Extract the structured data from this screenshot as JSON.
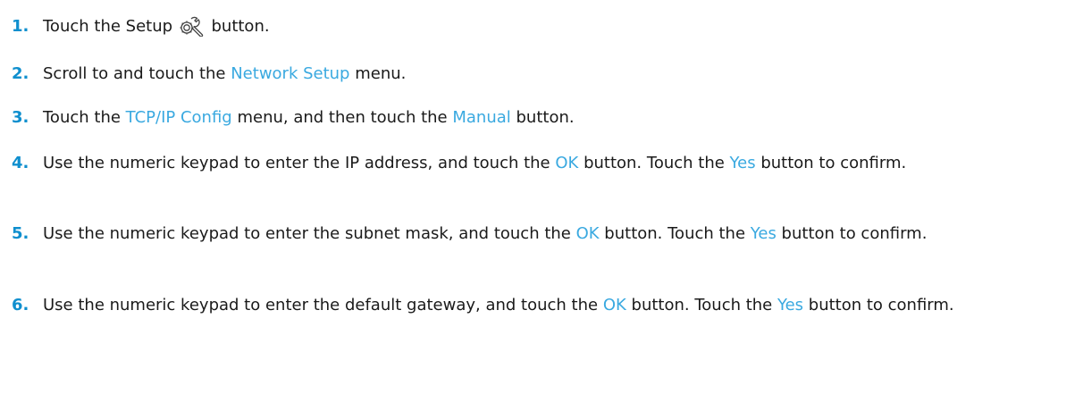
{
  "colors": {
    "step_number": "#0f8fce",
    "highlight": "#3aa9e0",
    "text": "#1a1a1a"
  },
  "steps": [
    {
      "number": "1.",
      "parts": [
        "Touch the Setup ",
        " button."
      ],
      "icon": "setup-wrench-gear-icon"
    },
    {
      "number": "2.",
      "parts": [
        "Scroll to and touch the ",
        "Network Setup",
        " menu."
      ]
    },
    {
      "number": "3.",
      "parts": [
        "Touch the ",
        "TCP/IP Config",
        " menu, and then touch the ",
        "Manual",
        " button."
      ]
    },
    {
      "number": "4.",
      "parts": [
        "Use the numeric keypad to enter the IP address, and touch the ",
        "OK",
        " button. Touch the ",
        "Yes",
        " button to confirm."
      ]
    },
    {
      "number": "5.",
      "parts": [
        "Use the numeric keypad to enter the subnet mask, and touch the ",
        "OK",
        " button. Touch the ",
        "Yes",
        " button to confirm."
      ]
    },
    {
      "number": "6.",
      "parts": [
        "Use the numeric keypad to enter the default gateway, and touch the ",
        "OK",
        " button. Touch the ",
        "Yes",
        " button to confirm."
      ]
    }
  ]
}
